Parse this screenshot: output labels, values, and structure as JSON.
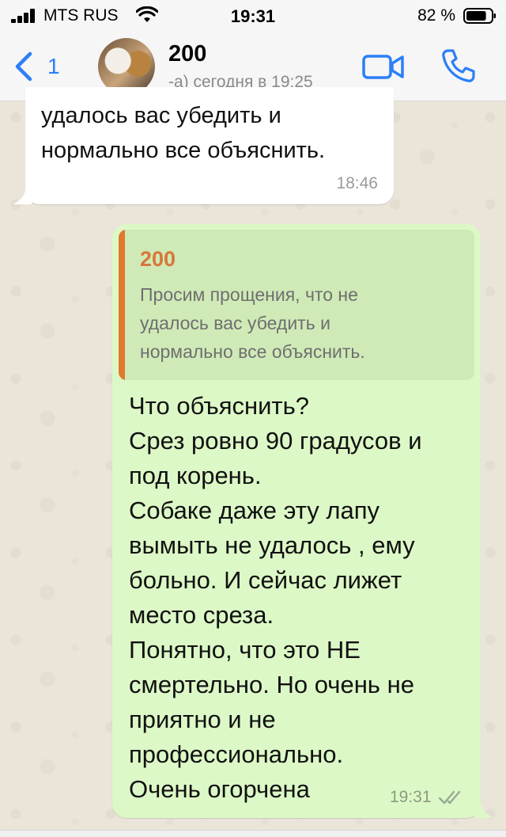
{
  "status_bar": {
    "carrier": "MTS RUS",
    "time": "19:31",
    "battery_percent": "82 %",
    "battery_level": 0.82
  },
  "header": {
    "back_count": "1",
    "contact_name": "200",
    "last_seen": "-а) сегодня в 19:25",
    "icons": [
      "chevron-left-icon",
      "video-call-icon",
      "phone-icon"
    ],
    "accent_color": "#2c7ff7"
  },
  "messages": [
    {
      "direction": "incoming",
      "text": "удалось вас убедить и\nнормально все объяснить.",
      "time": "18:46"
    },
    {
      "direction": "outgoing",
      "quote": {
        "author": "200",
        "text": "Просим прощения, что не\nудалось вас убедить и\nнормально все объяснить.",
        "accent_color": "#e0782e"
      },
      "text": "Что объяснить?\nСрез ровно 90 градусов и\nпод корень.\nСобаке даже эту лапу\nвымыть не удалось , ему\nбольно. И сейчас лижет\nместо среза.\nПонятно, что это НЕ\nсмертельно. Но очень не\nприятно и не\nпрофессионально.\nОчень огорчена",
      "time": "19:31",
      "status": "read",
      "bubble_color": "#dcf8c6"
    }
  ]
}
